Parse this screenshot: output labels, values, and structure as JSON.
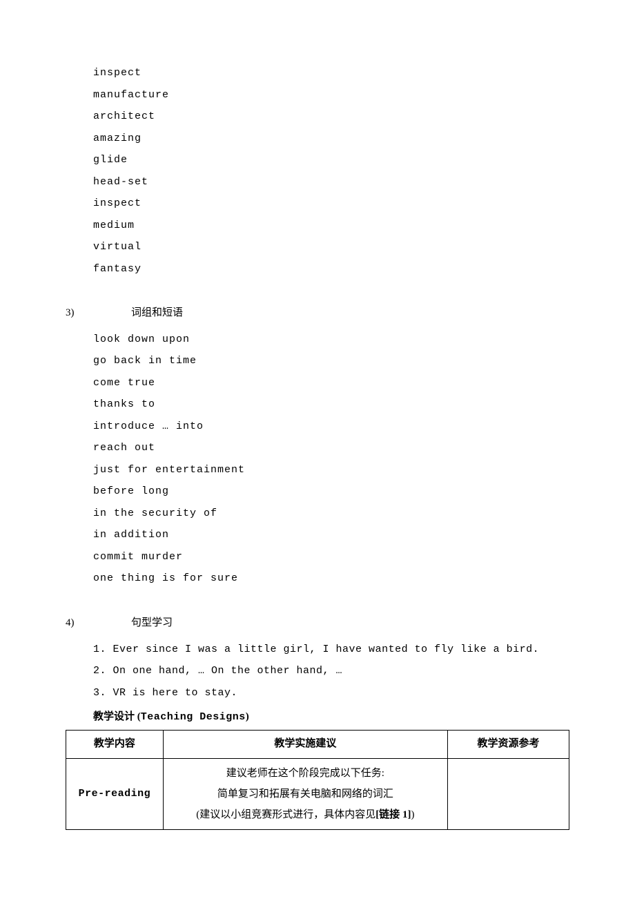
{
  "wordList1": [
    "inspect",
    "manufacture",
    "architect",
    "amazing",
    "glide",
    "head-set",
    "inspect",
    "medium",
    "virtual",
    "fantasy"
  ],
  "section3": {
    "num": "3)",
    "title": "词组和短语",
    "items": [
      "look down upon",
      "go back in time",
      "come true",
      "thanks to",
      "introduce … into",
      "reach out",
      "just for entertainment",
      "before long",
      "in the security of",
      "in addition",
      "commit murder",
      "one thing is for sure"
    ]
  },
  "section4": {
    "num": "4)",
    "title": "句型学习",
    "items": [
      "1. Ever since I was a little girl, I have wanted to fly like a bird.",
      "2. On one hand, … On the other hand, …",
      "3. VR is here to stay."
    ]
  },
  "designHeader": {
    "cn": "教学设计 (",
    "en": "Teaching Designs",
    "close": ")"
  },
  "table": {
    "headers": [
      "教学内容",
      "教学实施建议",
      "教学资源参考"
    ],
    "row1": {
      "col1": "Pre-reading",
      "col2_line1": "建议老师在这个阶段完成以下任务:",
      "col2_line2": "简单复习和拓展有关电脑和网络的词汇",
      "col2_line3_prefix": "(建议以小组竞赛形式进行，具体内容见",
      "col2_line3_bold": "[链接 1]",
      "col2_line3_suffix": ")",
      "col3": ""
    }
  }
}
